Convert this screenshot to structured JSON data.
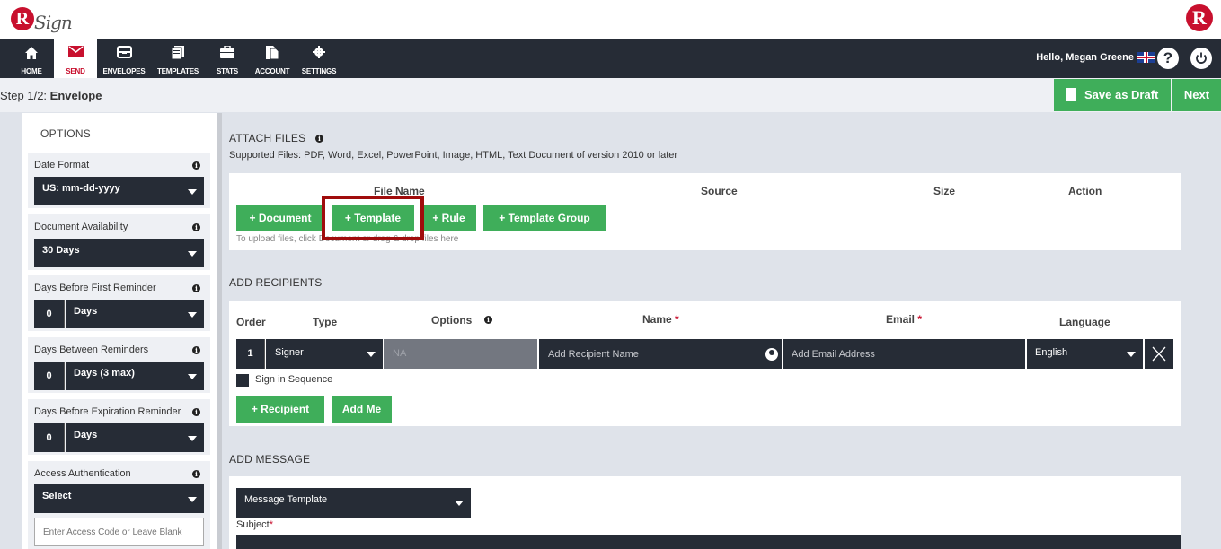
{
  "brand": {
    "logo_letter": "R",
    "logo_script": "Sign",
    "right_logo_letter": "R"
  },
  "nav": {
    "items": [
      {
        "label": "HOME",
        "icon": "home-icon"
      },
      {
        "label": "SEND",
        "icon": "envelope-icon"
      },
      {
        "label": "ENVELOPES",
        "icon": "inbox-icon"
      },
      {
        "label": "TEMPLATES",
        "icon": "templates-icon"
      },
      {
        "label": "STATS",
        "icon": "briefcase-icon"
      },
      {
        "label": "ACCOUNT",
        "icon": "account-icon"
      },
      {
        "label": "SETTINGS",
        "icon": "gear-icon"
      }
    ],
    "active": "SEND",
    "greeting": "Hello, Megan Greene",
    "help_glyph": "?"
  },
  "step": {
    "prefix": "Step 1/2:",
    "name": "Envelope"
  },
  "actions": {
    "save_draft": "Save as Draft",
    "next": "Next"
  },
  "options": {
    "title": "OPTIONS",
    "date_format": {
      "label": "Date Format",
      "value": "US: mm-dd-yyyy"
    },
    "availability": {
      "label": "Document Availability",
      "value": "30 Days"
    },
    "first_reminder": {
      "label": "Days Before First Reminder",
      "number": "0",
      "unit": "Days"
    },
    "between_reminders": {
      "label": "Days Between Reminders",
      "number": "0",
      "unit": "Days (3 max)"
    },
    "expiration_reminder": {
      "label": "Days Before Expiration Reminder",
      "number": "0",
      "unit": "Days"
    },
    "access_auth": {
      "label": "Access Authentication",
      "value": "Select",
      "placeholder": "Enter Access Code or Leave Blank"
    },
    "info_glyph": "i"
  },
  "attach": {
    "title": "ATTACH FILES",
    "supported": "Supported Files: PDF, Word, Excel, PowerPoint, Image, HTML, Text Document of version 2010 or later",
    "columns": [
      "File Name",
      "Source",
      "Size",
      "Action"
    ],
    "buttons": {
      "document": "+ Document",
      "template": "+ Template",
      "rule": "+ Rule",
      "template_group": "+ Template Group"
    },
    "hint": "To upload files, click Document or drag & drop files here"
  },
  "recipients": {
    "title": "ADD RECIPIENTS",
    "columns": {
      "order": "Order",
      "type": "Type",
      "options": "Options",
      "name": "Name",
      "email": "Email",
      "language": "Language",
      "required_mark": "*"
    },
    "row": {
      "order": "1",
      "type": "Signer",
      "options": "NA",
      "name_placeholder": "Add Recipient Name",
      "email_placeholder": "Add Email Address",
      "language": "English"
    },
    "sign_in_sequence": "Sign in Sequence",
    "add_recipient": "+ Recipient",
    "add_me": "Add Me"
  },
  "message": {
    "title": "ADD MESSAGE",
    "template_select": "Message Template",
    "subject_label": "Subject",
    "required_mark": "*"
  },
  "colors": {
    "accent_green": "#3fae5a",
    "dark": "#262c36",
    "brand_red": "#c8102e",
    "highlight": "#a00c0c"
  }
}
